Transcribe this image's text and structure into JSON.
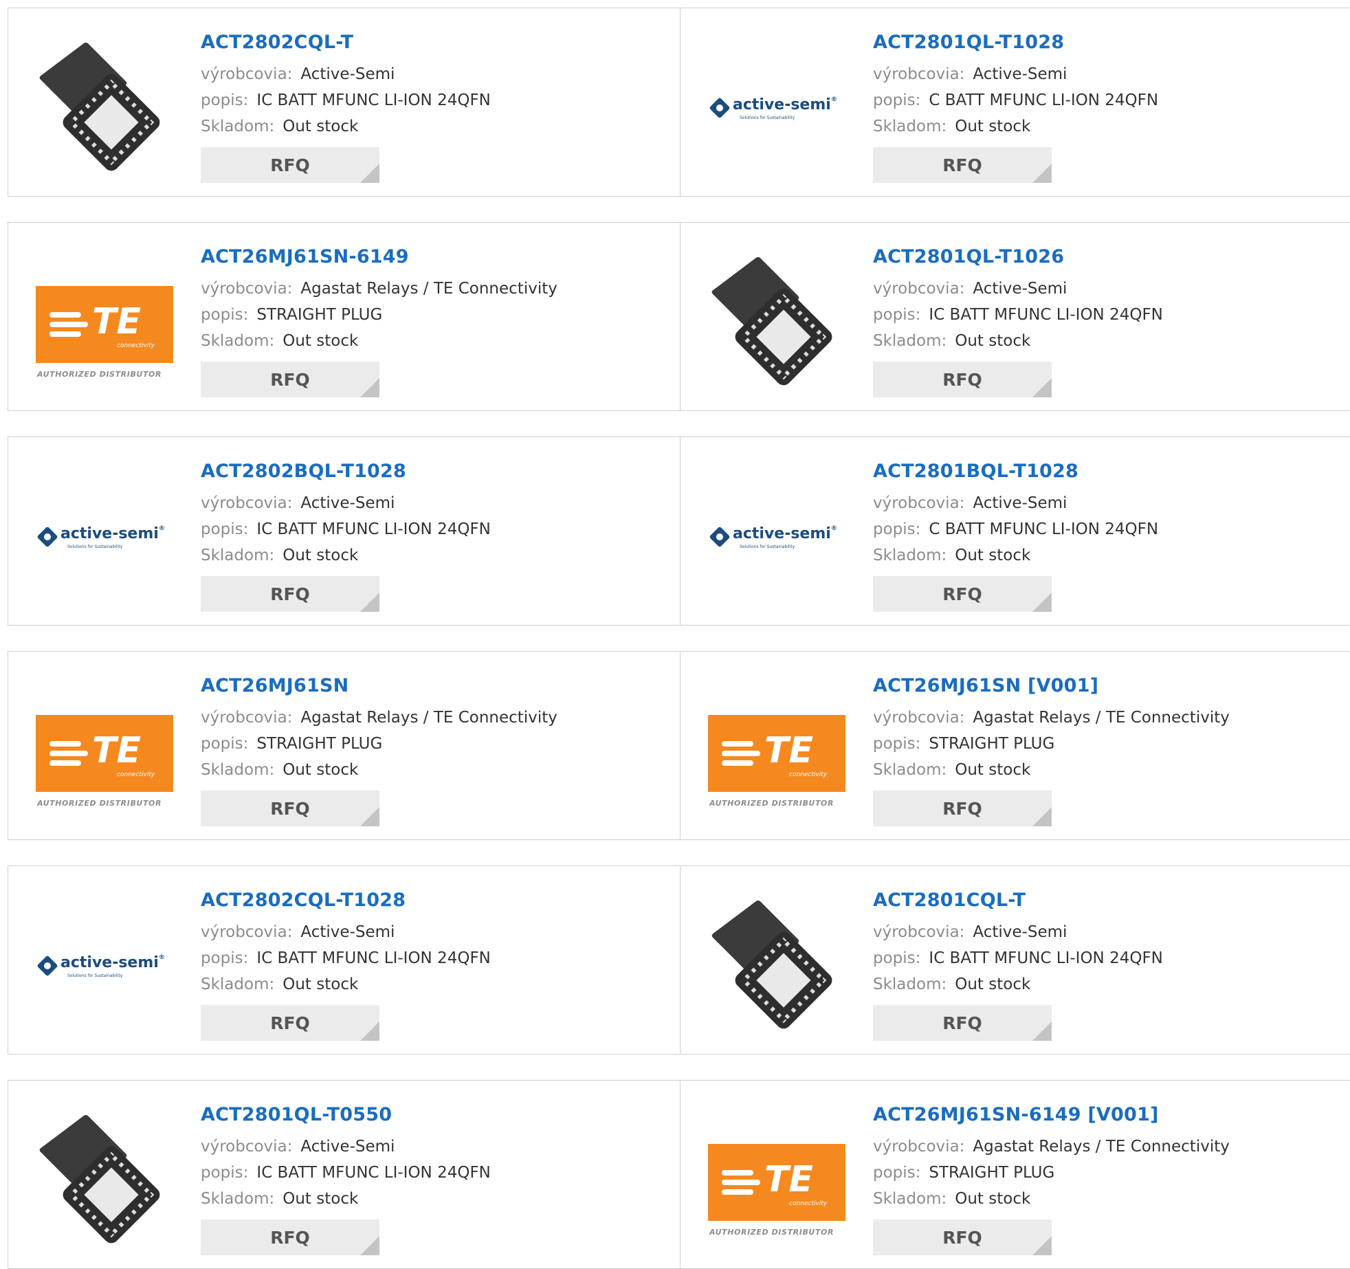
{
  "labels": {
    "manufacturer": "výrobcovia:",
    "description": "popis:",
    "stock": "Skladom:",
    "rfq": "RFQ"
  },
  "logos": {
    "active_semi": {
      "word": "active-semi",
      "registered": "®",
      "tagline": "Solutions for Sustainability"
    },
    "te": {
      "letters": "TE",
      "sub": "connectivity",
      "distributor": "AUTHORIZED DISTRIBUTOR"
    }
  },
  "colors": {
    "part_link": "#1a6dbf",
    "label_gray": "#8c8c8c",
    "button_bg": "#ebebeb",
    "te_orange": "#f5891f",
    "active_semi_blue": "#1b4d7e"
  },
  "products": [
    {
      "part": "ACT2802CQL-T",
      "manufacturer": "Active-Semi",
      "description": "IC BATT MFUNC LI-ION 24QFN",
      "stock": "Out stock",
      "image": "chip"
    },
    {
      "part": "ACT2801QL-T1028",
      "manufacturer": "Active-Semi",
      "description": "C BATT MFUNC LI-ION 24QFN",
      "stock": "Out stock",
      "image": "active-semi"
    },
    {
      "part": "ACT26MJ61SN-6149",
      "manufacturer": "Agastat Relays / TE Connectivity",
      "description": "STRAIGHT PLUG",
      "stock": "Out stock",
      "image": "te"
    },
    {
      "part": "ACT2801QL-T1026",
      "manufacturer": "Active-Semi",
      "description": "IC BATT MFUNC LI-ION 24QFN",
      "stock": "Out stock",
      "image": "chip"
    },
    {
      "part": "ACT2802BQL-T1028",
      "manufacturer": "Active-Semi",
      "description": "IC BATT MFUNC LI-ION 24QFN",
      "stock": "Out stock",
      "image": "active-semi"
    },
    {
      "part": "ACT2801BQL-T1028",
      "manufacturer": "Active-Semi",
      "description": "C BATT MFUNC LI-ION 24QFN",
      "stock": "Out stock",
      "image": "active-semi"
    },
    {
      "part": "ACT26MJ61SN",
      "manufacturer": "Agastat Relays / TE Connectivity",
      "description": "STRAIGHT PLUG",
      "stock": "Out stock",
      "image": "te"
    },
    {
      "part": "ACT26MJ61SN [V001]",
      "manufacturer": "Agastat Relays / TE Connectivity",
      "description": "STRAIGHT PLUG",
      "stock": "Out stock",
      "image": "te"
    },
    {
      "part": "ACT2802CQL-T1028",
      "manufacturer": "Active-Semi",
      "description": "IC BATT MFUNC LI-ION 24QFN",
      "stock": "Out stock",
      "image": "active-semi"
    },
    {
      "part": "ACT2801CQL-T",
      "manufacturer": "Active-Semi",
      "description": "IC BATT MFUNC LI-ION 24QFN",
      "stock": "Out stock",
      "image": "chip"
    },
    {
      "part": "ACT2801QL-T0550",
      "manufacturer": "Active-Semi",
      "description": "IC BATT MFUNC LI-ION 24QFN",
      "stock": "Out stock",
      "image": "chip"
    },
    {
      "part": "ACT26MJ61SN-6149 [V001]",
      "manufacturer": "Agastat Relays / TE Connectivity",
      "description": "STRAIGHT PLUG",
      "stock": "Out stock",
      "image": "te"
    }
  ]
}
